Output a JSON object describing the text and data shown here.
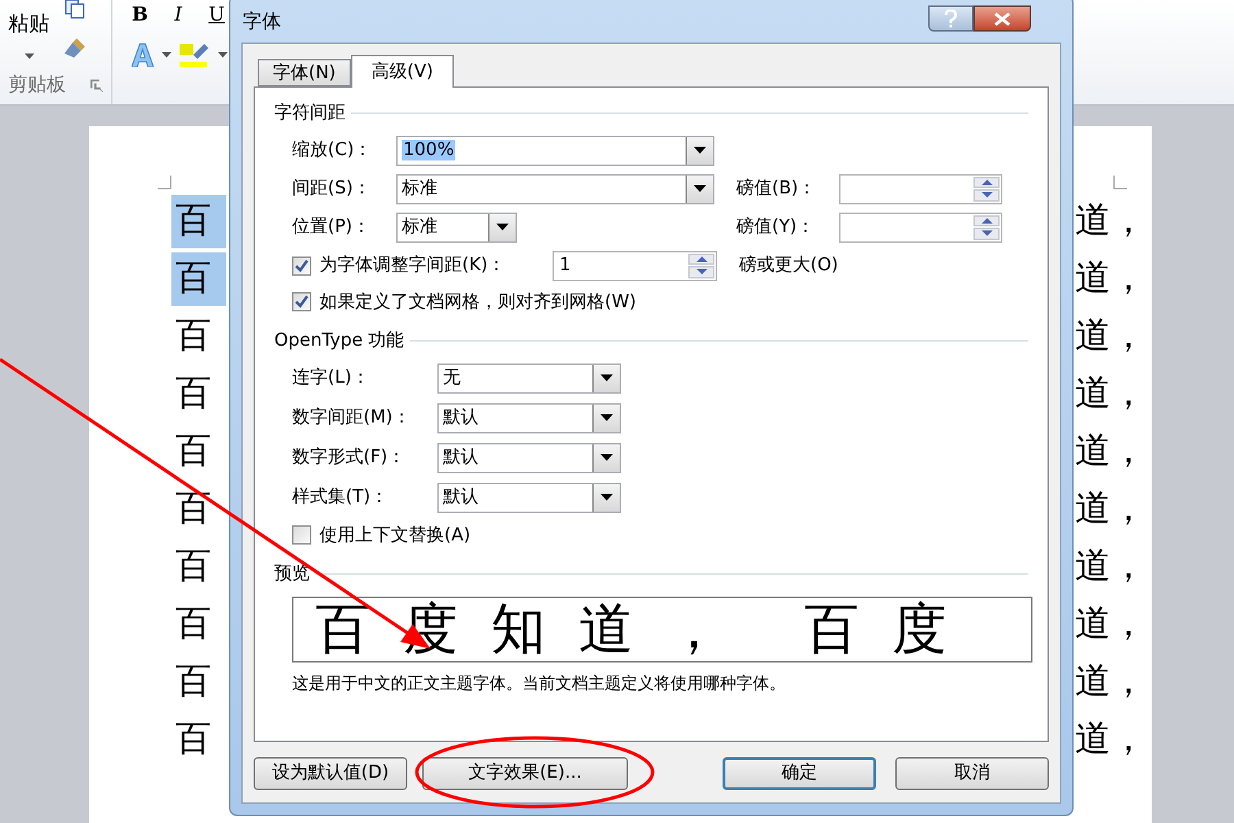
{
  "ribbon": {
    "paste": "粘贴",
    "group_label": "剪贴板",
    "format_buttons": [
      "B",
      "I",
      "U"
    ]
  },
  "document": {
    "lines": [
      {
        "left": "百",
        "right": "道，",
        "selected": true
      },
      {
        "left": "百",
        "right": "道，",
        "selected": true
      },
      {
        "left": "百",
        "right": "道，",
        "selected": false
      },
      {
        "left": "百",
        "right": "道，",
        "selected": false
      },
      {
        "left": "百",
        "right": "道，",
        "selected": false
      },
      {
        "left": "百",
        "right": "道，",
        "selected": false
      },
      {
        "left": "百",
        "right": "道，",
        "selected": false
      },
      {
        "left": "百",
        "right": "道，",
        "selected": false
      },
      {
        "left": "百",
        "right": "道，",
        "selected": false
      },
      {
        "left": "百",
        "right": "道，",
        "selected": false
      }
    ]
  },
  "dialog": {
    "title": "字体",
    "tabs": [
      {
        "label": "字体(N)",
        "selected": false
      },
      {
        "label": "高级(V)",
        "selected": true
      }
    ],
    "character_spacing": {
      "title": "字符间距",
      "scale": {
        "label": "缩放(C)：",
        "value": "100%",
        "value_selected": true
      },
      "spacing": {
        "label": "间距(S)：",
        "value": "标准"
      },
      "spacing_by": {
        "label": "磅值(B)："
      },
      "position": {
        "label": "位置(P)：",
        "value": "标准"
      },
      "position_by": {
        "label": "磅值(Y)："
      },
      "kerning": {
        "label": "为字体调整字间距(K)：",
        "checked": true,
        "value": "1",
        "suffix": "磅或更大(O)"
      },
      "snap_to_grid": {
        "label": "如果定义了文档网格，则对齐到网格(W)",
        "checked": true
      }
    },
    "opentype": {
      "title": "OpenType 功能",
      "dropdowns": [
        {
          "label": "连字(L)：",
          "value": "无"
        },
        {
          "label": "数字间距(M)：",
          "value": "默认"
        },
        {
          "label": "数字形式(F)：",
          "value": "默认"
        },
        {
          "label": "样式集(T)：",
          "value": "默认"
        }
      ],
      "contextual": {
        "label": "使用上下文替换(A)",
        "checked": false
      }
    },
    "preview": {
      "title": "预览",
      "sample": "百度知道， 百度",
      "note": "这是用于中文的正文主题字体。当前文档主题定义将使用哪种字体。"
    },
    "buttons": [
      {
        "label": "设为默认值(D)",
        "default": false
      },
      {
        "label": "文字效果(E)...",
        "default": false
      },
      {
        "label": "确定",
        "default": true
      },
      {
        "label": "取消",
        "default": false
      }
    ]
  }
}
